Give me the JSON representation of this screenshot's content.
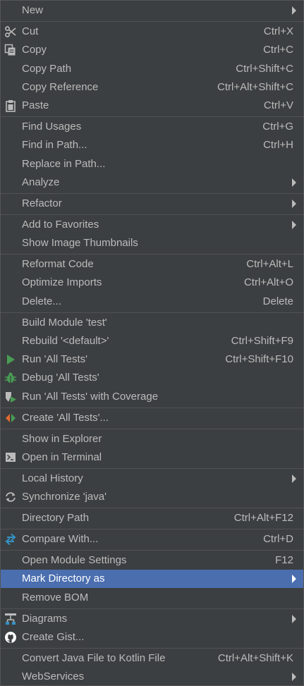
{
  "menu": {
    "new": {
      "label": "New"
    },
    "cut": {
      "label": "Cut",
      "shortcut": "Ctrl+X",
      "icon": "scissors-icon"
    },
    "copy": {
      "label": "Copy",
      "shortcut": "Ctrl+C",
      "icon": "copy-icon"
    },
    "copy_path": {
      "label": "Copy Path",
      "shortcut": "Ctrl+Shift+C"
    },
    "copy_reference": {
      "label": "Copy Reference",
      "shortcut": "Ctrl+Alt+Shift+C"
    },
    "paste": {
      "label": "Paste",
      "shortcut": "Ctrl+V",
      "icon": "clipboard-icon"
    },
    "find_usages": {
      "label": "Find Usages",
      "shortcut": "Ctrl+G"
    },
    "find_in_path": {
      "label": "Find in Path...",
      "shortcut": "Ctrl+H"
    },
    "replace_in_path": {
      "label": "Replace in Path..."
    },
    "analyze": {
      "label": "Analyze"
    },
    "refactor": {
      "label": "Refactor"
    },
    "add_to_favorites": {
      "label": "Add to Favorites"
    },
    "show_image_thumbnails": {
      "label": "Show Image Thumbnails"
    },
    "reformat_code": {
      "label": "Reformat Code",
      "shortcut": "Ctrl+Alt+L"
    },
    "optimize_imports": {
      "label": "Optimize Imports",
      "shortcut": "Ctrl+Alt+O"
    },
    "delete": {
      "label": "Delete...",
      "shortcut": "Delete"
    },
    "build_module": {
      "label": "Build Module 'test'"
    },
    "rebuild": {
      "label": "Rebuild '<default>'",
      "shortcut": "Ctrl+Shift+F9"
    },
    "run_all_tests": {
      "label": "Run 'All Tests'",
      "shortcut": "Ctrl+Shift+F10",
      "icon": "run-icon"
    },
    "debug_all_tests": {
      "label": "Debug 'All Tests'",
      "icon": "debug-bug-icon"
    },
    "run_with_coverage": {
      "label": "Run 'All Tests' with Coverage",
      "icon": "coverage-icon"
    },
    "create_all_tests": {
      "label": "Create 'All Tests'...",
      "icon": "create-config-icon"
    },
    "show_in_explorer": {
      "label": "Show in Explorer"
    },
    "open_in_terminal": {
      "label": "Open in Terminal",
      "icon": "terminal-icon"
    },
    "local_history": {
      "label": "Local History"
    },
    "synchronize": {
      "label": "Synchronize 'java'",
      "icon": "sync-icon"
    },
    "directory_path": {
      "label": "Directory Path",
      "shortcut": "Ctrl+Alt+F12"
    },
    "compare_with": {
      "label": "Compare With...",
      "shortcut": "Ctrl+D",
      "icon": "compare-arrows-icon"
    },
    "open_module_settings": {
      "label": "Open Module Settings",
      "shortcut": "F12"
    },
    "mark_directory_as": {
      "label": "Mark Directory as"
    },
    "remove_bom": {
      "label": "Remove BOM"
    },
    "diagrams": {
      "label": "Diagrams",
      "icon": "diagram-icon"
    },
    "create_gist": {
      "label": "Create Gist...",
      "icon": "github-icon"
    },
    "convert_java": {
      "label": "Convert Java File to Kotlin File",
      "shortcut": "Ctrl+Alt+Shift+K"
    },
    "webservices": {
      "label": "WebServices"
    }
  },
  "colors": {
    "background": "#3c3f41",
    "text": "#bbbbbb",
    "selection": "#4b6eaf",
    "separator": "#515151",
    "run_green": "#499c54",
    "compare_blue": "#3592c4",
    "create_orange": "#e06a2f"
  }
}
